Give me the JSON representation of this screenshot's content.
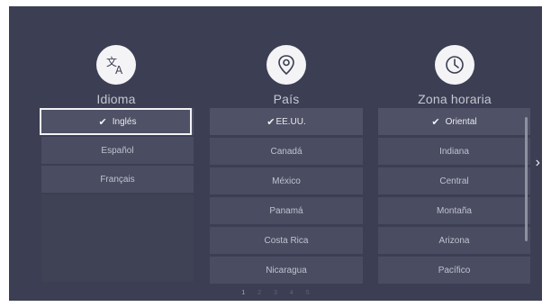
{
  "columns": [
    {
      "title": "Idioma",
      "icon": "translate-icon",
      "items": [
        "Inglés",
        "Español",
        "Français"
      ],
      "selected": 0
    },
    {
      "title": "País",
      "icon": "location-pin-icon",
      "items": [
        "EE.UU.",
        "Canadá",
        "México",
        "Panamá",
        "Costa Rica",
        "Nicaragua"
      ],
      "selected": 0
    },
    {
      "title": "Zona horaria",
      "icon": "clock-icon",
      "items": [
        "Oriental",
        "Indiana",
        "Central",
        "Montaña",
        "Arizona",
        "Pacífico"
      ],
      "selected": 0
    }
  ],
  "check_glyph": "✔",
  "pager": [
    "1",
    "2",
    "3",
    "4",
    "5"
  ],
  "pager_current": "1",
  "next_arrow": "›",
  "colors": {
    "background": "#3c3e53",
    "item": "#4a4c62",
    "focus": "#f2f2f5"
  }
}
